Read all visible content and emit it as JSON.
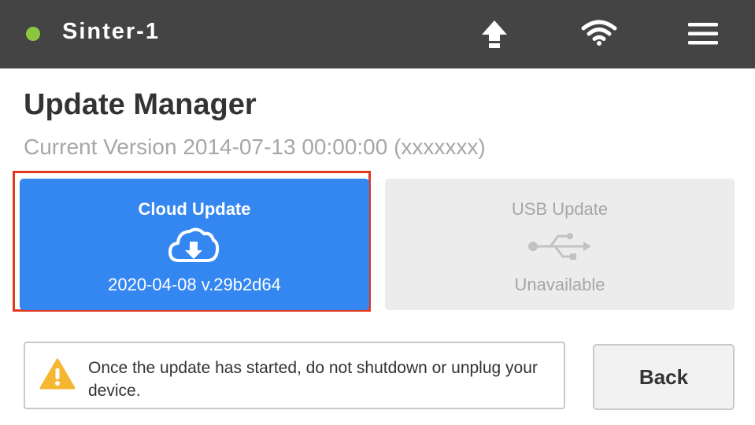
{
  "topbar": {
    "device_name": "Sinter-1",
    "status_color": "#8ac73e",
    "icons": [
      "upload-icon",
      "wifi-icon",
      "menu-icon"
    ]
  },
  "page": {
    "title": "Update Manager",
    "current_version": "Current Version 2014-07-13 00:00:00 (xxxxxxx)"
  },
  "cloud_update": {
    "label": "Cloud Update",
    "version": "2020-04-08 v.29b2d64",
    "icon": "cloud-download-icon",
    "color": "#3487f0"
  },
  "usb_update": {
    "label": "USB Update",
    "status": "Unavailable",
    "icon": "usb-icon"
  },
  "warning": {
    "icon": "warning-icon",
    "text": "Once the update has started, do not shutdown or unplug your device."
  },
  "back_button": {
    "label": "Back"
  },
  "colors": {
    "highlight": "#e0391f",
    "topbar": "#444444",
    "warning": "#f5b731"
  }
}
